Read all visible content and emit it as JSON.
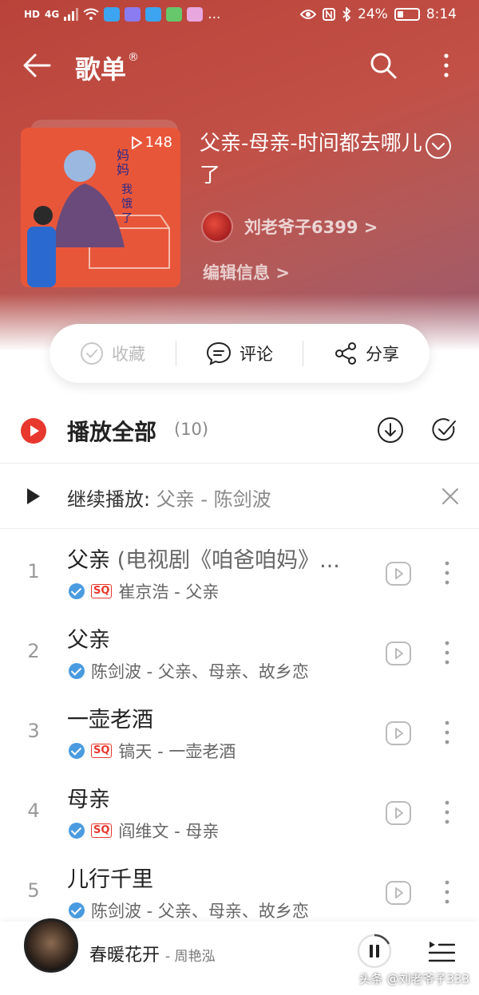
{
  "status_bar": {
    "left_badges": [
      "HD",
      "4G"
    ],
    "battery_text": "24%",
    "time": "8:14",
    "dots": "..."
  },
  "header": {
    "title": "歌单",
    "title_mark": "®"
  },
  "playlist": {
    "play_count": "148",
    "title": "父亲-母亲-时间都去哪儿了",
    "author": "刘老爷子6399",
    "author_chevron": ">",
    "edit_label": "编辑信息",
    "edit_chevron": ">"
  },
  "actions": {
    "favorite": "收藏",
    "comment": "评论",
    "share": "分享"
  },
  "play_all": {
    "label": "播放全部",
    "count": "(10)"
  },
  "continue": {
    "label": "继续播放:",
    "song": "父亲 - 陈剑波"
  },
  "songs": [
    {
      "index": "1",
      "title": "父亲",
      "subtitle": "(电视剧《咱爸咱妈》...",
      "sq": true,
      "meta": "崔京浩 - 父亲"
    },
    {
      "index": "2",
      "title": "父亲",
      "subtitle": "",
      "sq": false,
      "meta": "陈剑波 - 父亲、母亲、故乡恋"
    },
    {
      "index": "3",
      "title": "一壶老酒",
      "subtitle": "",
      "sq": true,
      "meta": "镐天 - 一壶老酒"
    },
    {
      "index": "4",
      "title": "母亲",
      "subtitle": "",
      "sq": true,
      "meta": "阎维文 - 母亲"
    },
    {
      "index": "5",
      "title": "儿行千里",
      "subtitle": "",
      "sq": false,
      "meta": "陈剑波 - 父亲、母亲、故乡恋"
    }
  ],
  "sq_label": "SQ",
  "mini_player": {
    "title": "春暖花开",
    "artist": "- 周艳泓"
  },
  "watermark": "头条 @刘老爷子333",
  "colors": {
    "accent": "#e8372d",
    "hero": "#c04b41",
    "verified": "#4a9be0"
  }
}
